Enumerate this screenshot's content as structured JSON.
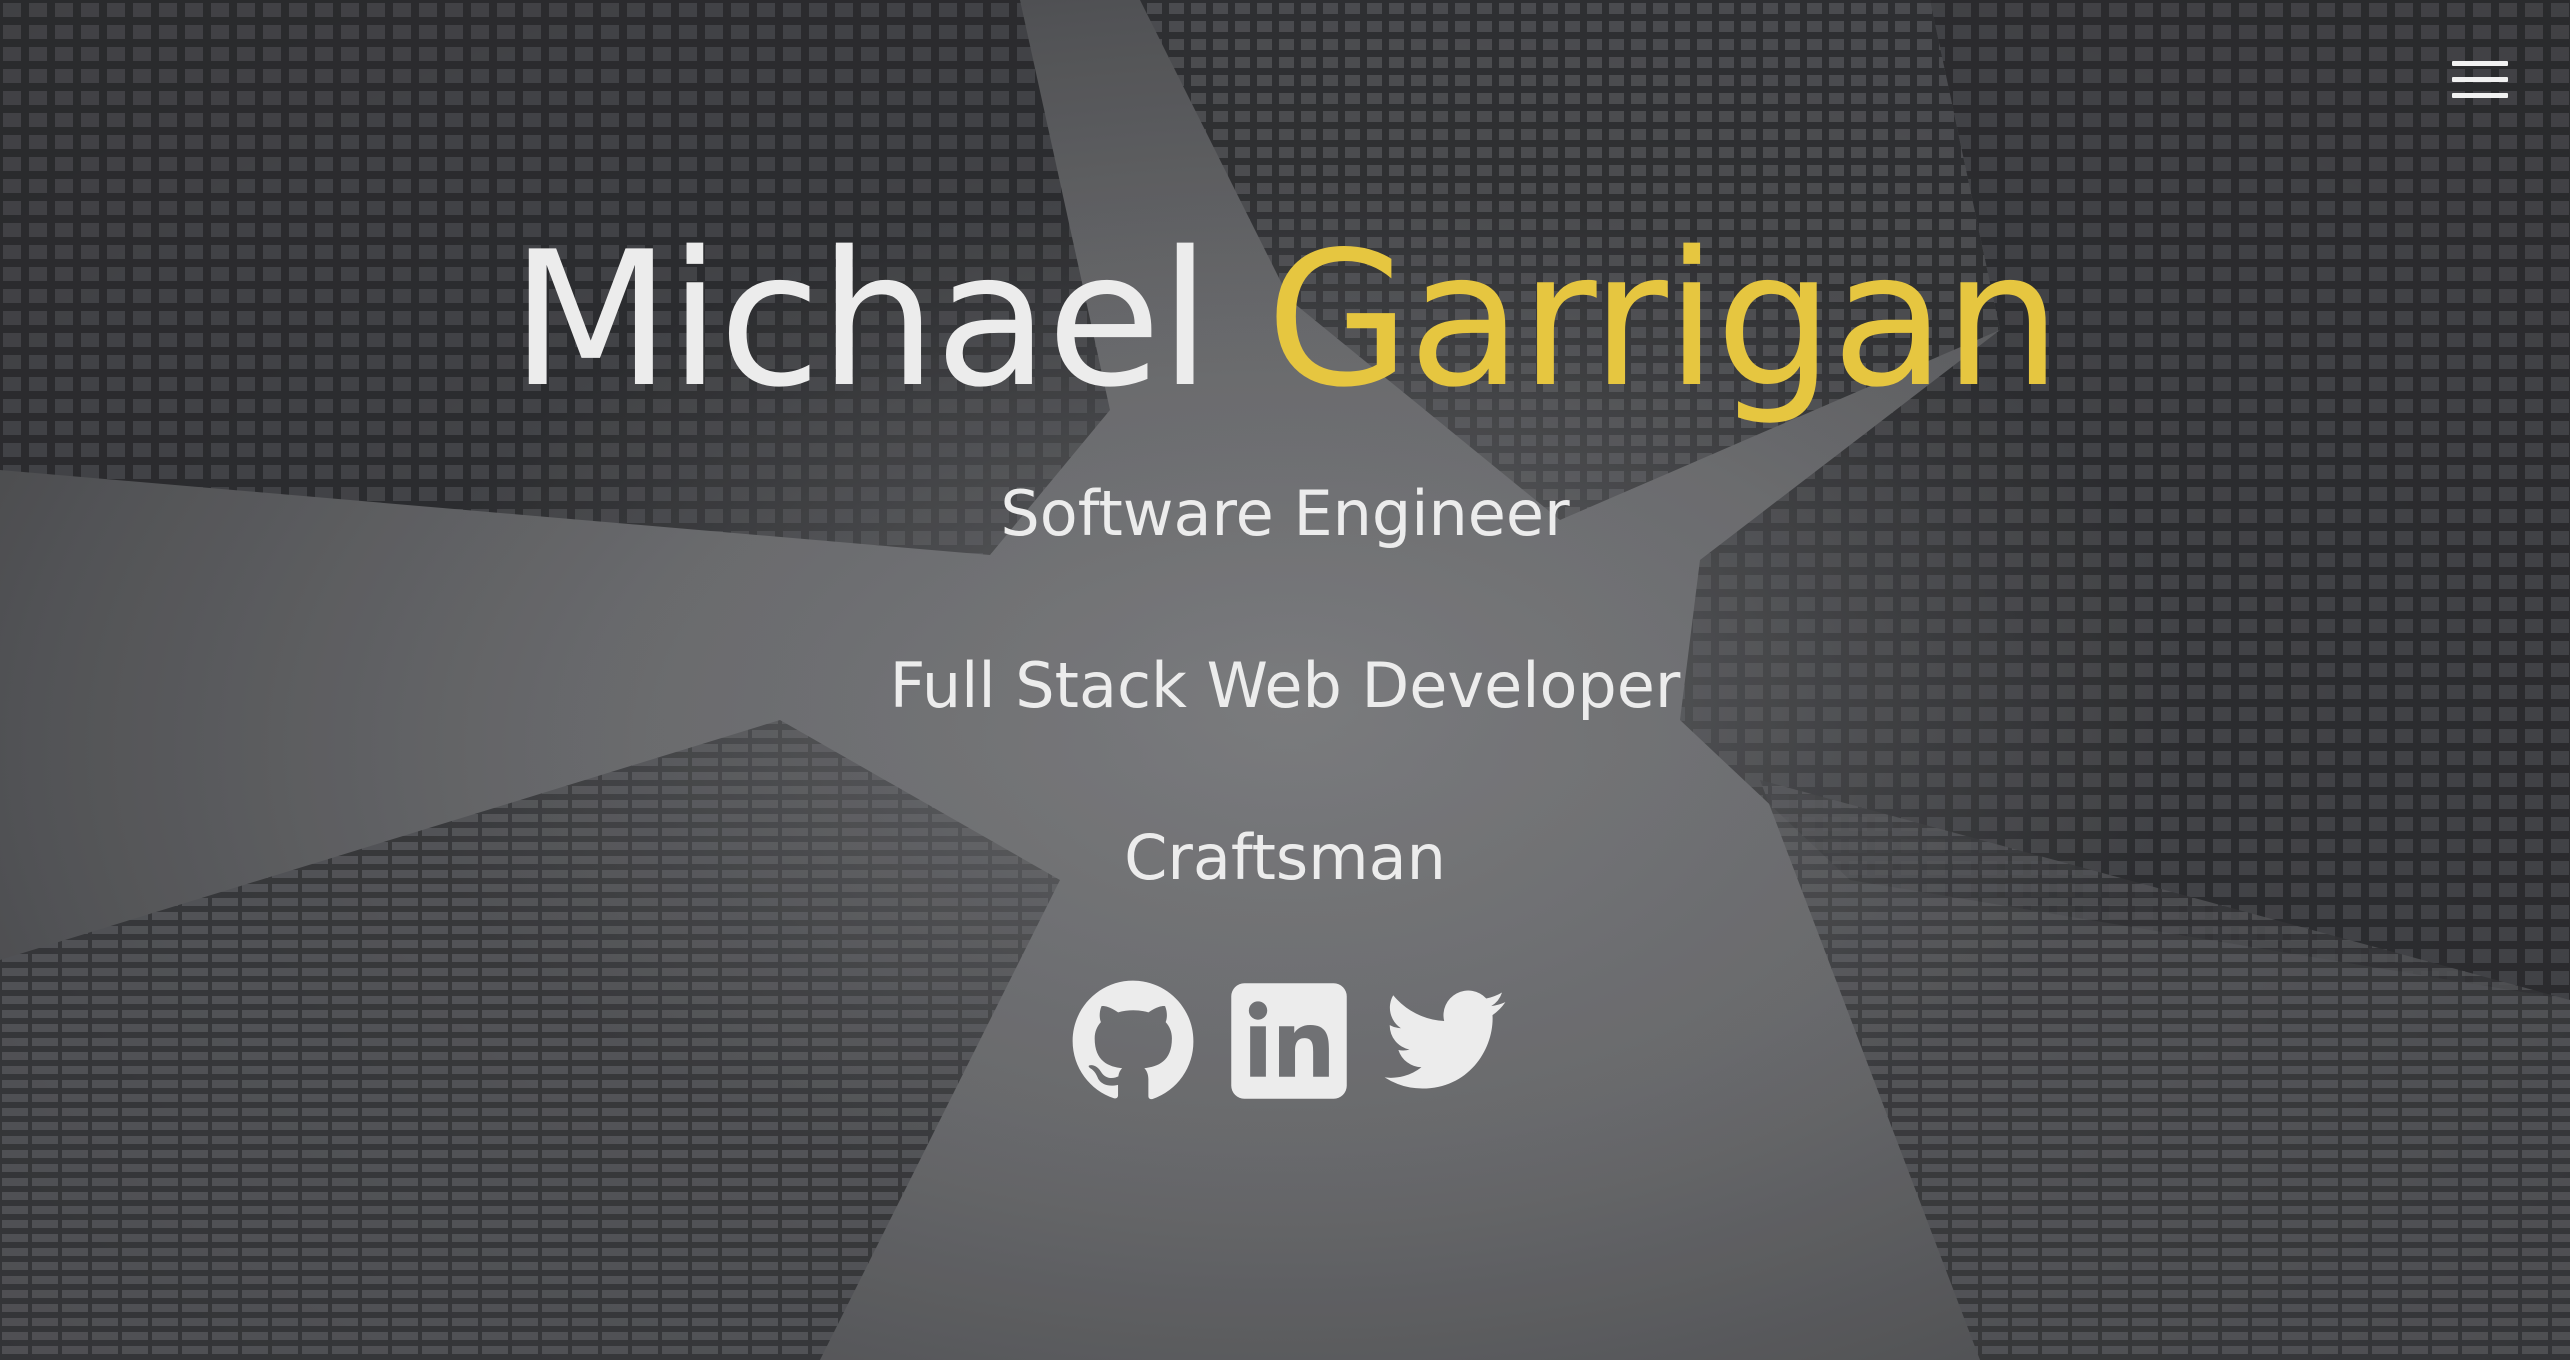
{
  "header": {
    "first_name": "Michael",
    "last_name": "Garrigan",
    "accent_color": "#e6c640"
  },
  "subtitles": [
    "Software Engineer",
    "Full Stack Web Developer",
    "Craftsman"
  ],
  "socials": [
    {
      "name": "github",
      "icon": "github-icon"
    },
    {
      "name": "linkedin",
      "icon": "linkedin-icon"
    },
    {
      "name": "twitter",
      "icon": "twitter-icon"
    }
  ],
  "nav": {
    "menu_icon": "hamburger-menu-icon"
  },
  "colors": {
    "text": "#ececec",
    "accent": "#e6c640",
    "background": "#6f7073"
  }
}
